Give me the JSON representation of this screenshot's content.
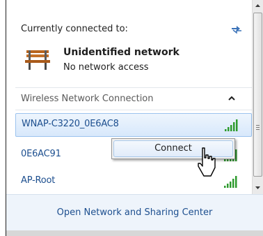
{
  "status": {
    "section_title": "Currently connected to:",
    "network_name": "Unidentified network",
    "network_status": "No network access"
  },
  "wireless": {
    "group_label": "Wireless Network Connection",
    "networks": [
      {
        "name": "WNAP-C3220_0E6AC8",
        "selected": true,
        "signal_bars": 5
      },
      {
        "name": "0E6AC91",
        "selected": false,
        "signal_bars": 5
      },
      {
        "name": "AP-Root",
        "selected": false,
        "signal_bars": 5
      }
    ]
  },
  "context_menu": {
    "items": [
      "Connect"
    ]
  },
  "footer": {
    "link_label": "Open Network and Sharing Center"
  },
  "colors": {
    "link_blue": "#1d4f8f",
    "signal_green": "#2e9b2e",
    "footer_bg": "#eef4fb"
  },
  "icons": {
    "status": "bench-icon",
    "refresh": "refresh-icon",
    "collapse": "chevron-up-icon",
    "signal": "signal-strength-icon",
    "cursor": "mouse-pointer-icon"
  }
}
